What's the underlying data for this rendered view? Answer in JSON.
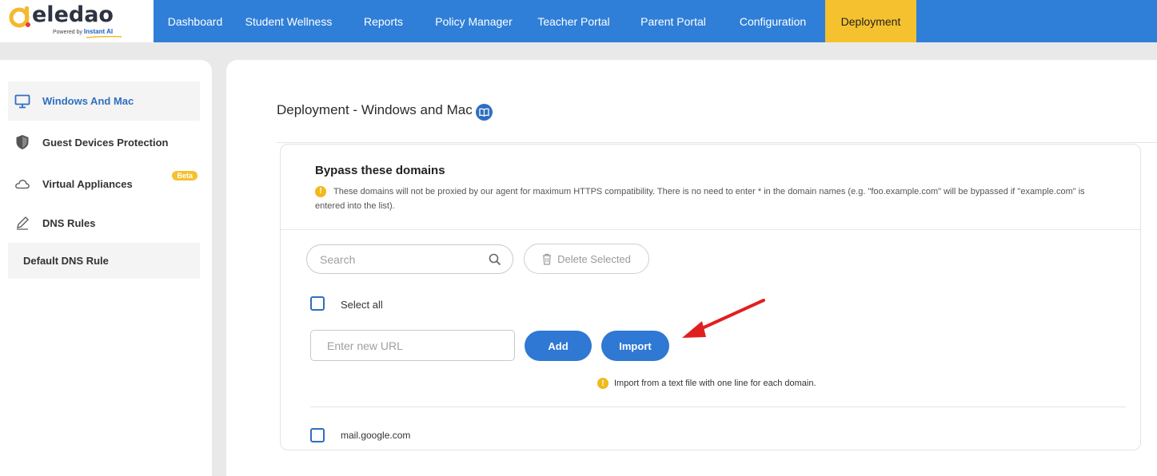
{
  "brand": {
    "name": "eledao",
    "powered_by": "Powered by",
    "powered_brand": "Instant AI"
  },
  "nav": {
    "items": [
      {
        "label": "Dashboard"
      },
      {
        "label": "Student Wellness"
      },
      {
        "label": "Reports"
      },
      {
        "label": "Policy Manager"
      },
      {
        "label": "Teacher Portal"
      },
      {
        "label": "Parent Portal"
      },
      {
        "label": "Configuration"
      },
      {
        "label": "Deployment",
        "active": true
      }
    ]
  },
  "sidebar": {
    "items": [
      {
        "label": "Windows And Mac",
        "icon": "monitor-icon",
        "active": true
      },
      {
        "label": "Guest Devices Protection",
        "icon": "shield-icon"
      },
      {
        "label": "Virtual Appliances",
        "icon": "cloud-icon",
        "badge": "Beta"
      },
      {
        "label": "DNS Rules",
        "icon": "pencil-icon"
      }
    ],
    "sub_items": [
      {
        "label": "Default DNS Rule"
      }
    ]
  },
  "main": {
    "title": "Deployment - Windows and Mac",
    "title_icon": "book-icon",
    "card": {
      "title": "Bypass these domains",
      "description": "These domains will not be proxied by our agent for maximum HTTPS compatibility. There is no need to enter * in the domain names (e.g. \"foo.example.com\" will be bypassed if \"example.com\" is entered into the list).",
      "search_placeholder": "Search",
      "delete_selected_label": "Delete Selected",
      "select_all_label": "Select all",
      "url_placeholder": "Enter new URL",
      "add_label": "Add",
      "import_label": "Import",
      "import_hint": "Import from a text file with one line for each domain.",
      "domains": [
        "mail.google.com"
      ]
    }
  },
  "colors": {
    "nav_bg": "#2f7fd8",
    "nav_active": "#f5c12e",
    "primary": "#2f78d3",
    "info": "#f1b91d",
    "arrow": "#e02020"
  }
}
